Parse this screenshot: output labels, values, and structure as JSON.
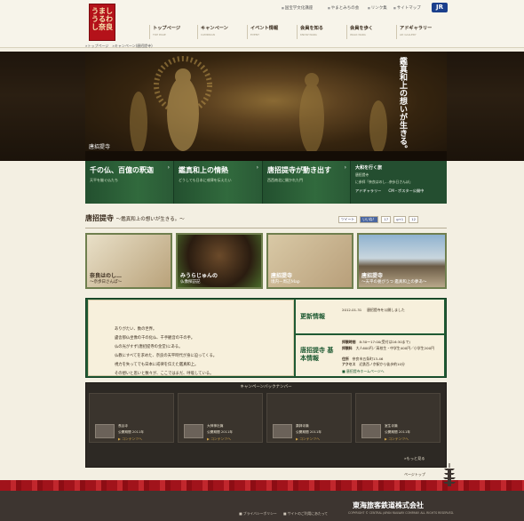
{
  "logo": {
    "text": "うましうるわし奈良"
  },
  "utility_links": [
    "国宝学文化講座",
    "やまとみちの会",
    "リンク集",
    "サイトマップ"
  ],
  "brand": {
    "jr": "JR"
  },
  "nav": [
    {
      "label": "トップページ",
      "sub": "TOP PAGE"
    },
    {
      "label": "キャンペーン",
      "sub": "CAMPAIGN"
    },
    {
      "label": "イベント情報",
      "sub": "EVENT"
    },
    {
      "label": "会員を知る",
      "sub": "KNOW NARA"
    },
    {
      "label": "会員を歩く",
      "sub": "WALK NARA"
    },
    {
      "label": "アドギャラリー",
      "sub": "AD GALLERY"
    }
  ],
  "breadcrumb": "»トップページ　»キャンペーン(唐招提寺)",
  "hero": {
    "vertical": "鑑真和上の想いが生きる。",
    "caption": "唐招提寺"
  },
  "banners": [
    {
      "title": "千の仏、百億の釈迦",
      "sub": "天平を継ぐ仏たち"
    },
    {
      "title": "鑑真和上の情熱",
      "sub": "どうしても日本に戒律を伝えたい"
    },
    {
      "title": "唐招提寺が動き出す",
      "sub": "西西南北に開かれた門"
    }
  ],
  "side": {
    "line1": "大和を行く旅",
    "line2": "唐招提寺",
    "line3": "に参拝「奈良はのし…奈歩日さんぽ」",
    "gallery": "アドギャラリー",
    "cm": "CM・ポスター公開中"
  },
  "section": {
    "title": "唐招提寺",
    "subtitle": "〜鑑真和上の想いが生きる。〜"
  },
  "social": [
    "ツイート",
    "いいね！",
    "17",
    "g+1",
    "12"
  ],
  "cards": [
    {
      "label2": "奈良はのし…",
      "label": "〜奈歩日さんぽ〜"
    },
    {
      "label2": "みうらじゅんの",
      "label": "仏像探訪記"
    },
    {
      "label2": "唐招提寺",
      "label": "境内ー周辺Map"
    },
    {
      "label2": "唐招提寺",
      "label": "〜天平の甍がうつ 鑑真和上の夢あ〜"
    }
  ],
  "poem": [
    "ありがたい、数の世界。",
    "盧舎那仏坐像の千の化仏、千手観音の千の手。",
    "仏の光がすず(唐招提寺の金堂)にある。",
    "仏教にすべてを求めた、奈良の天平時代が身に迫ってくる。",
    "視力を失ってでも日本に戒律を伝えた鑑真和上。",
    "その想いと思いと数々が、ここではまだ、呼吸している。"
  ],
  "news": {
    "heading": "更新情報",
    "date": "2012.01.31",
    "text": "唐招提寺を公開しました"
  },
  "basic": {
    "heading": "唐招提寺 基本情報",
    "rows": [
      {
        "k": "拝観時間",
        "v": "8:30〜17:00(受付は16:30まで)"
      },
      {
        "k": "拝観料",
        "v": "大人600円／高校生・中学生400円／小学生200円"
      },
      {
        "k": "住所",
        "v": "奈良市五条町13-46"
      },
      {
        "k": "アクセス",
        "v": "近鉄西ノ京駅から徒歩約10分"
      }
    ],
    "link": "唐招提寺ホームページへ"
  },
  "campaign": {
    "heading": "キャンペーンバックナンバー",
    "items": [
      {
        "t1": "長谷寺",
        "t2": "公開期間 2011年",
        "link": "コンテンツへ"
      },
      {
        "t1": "大神神社篇",
        "t2": "公開期間 2011年",
        "link": "コンテンツへ"
      },
      {
        "t1": "薬師寺篇",
        "t2": "公開期間 2011年",
        "link": "コンテンツへ"
      },
      {
        "t1": "室生寺篇",
        "t2": "公開期間 2011年",
        "link": "コンテンツへ"
      }
    ],
    "more": "»もっと見る"
  },
  "pagetop": "ページトップ",
  "footer": {
    "corp": "東海旅客鉄道株式会社",
    "links": [
      "プライバシーポリシー",
      "サイトのご利用にあたって"
    ],
    "copy": "COPYRIGHT © CENTRAL JAPAN RAILWAY COMPANY. ALL RIGHTS RESERVED."
  }
}
